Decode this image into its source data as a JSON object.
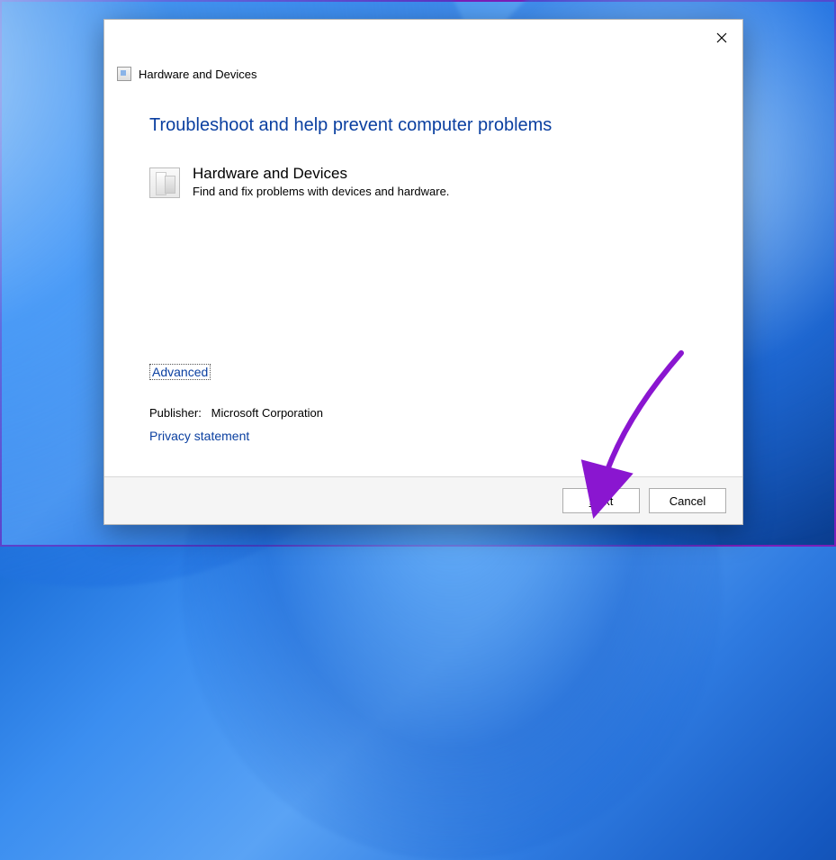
{
  "window": {
    "title": "Hardware and Devices"
  },
  "content": {
    "heading": "Troubleshoot and help prevent computer problems",
    "item_title": "Hardware and Devices",
    "item_description": "Find and fix problems with devices and hardware."
  },
  "links": {
    "advanced": "Advanced",
    "privacy": "Privacy statement"
  },
  "publisher": {
    "label": "Publisher:",
    "name": "Microsoft Corporation"
  },
  "buttons": {
    "next_prefix": "N",
    "next_rest": "ext",
    "cancel": "Cancel"
  }
}
